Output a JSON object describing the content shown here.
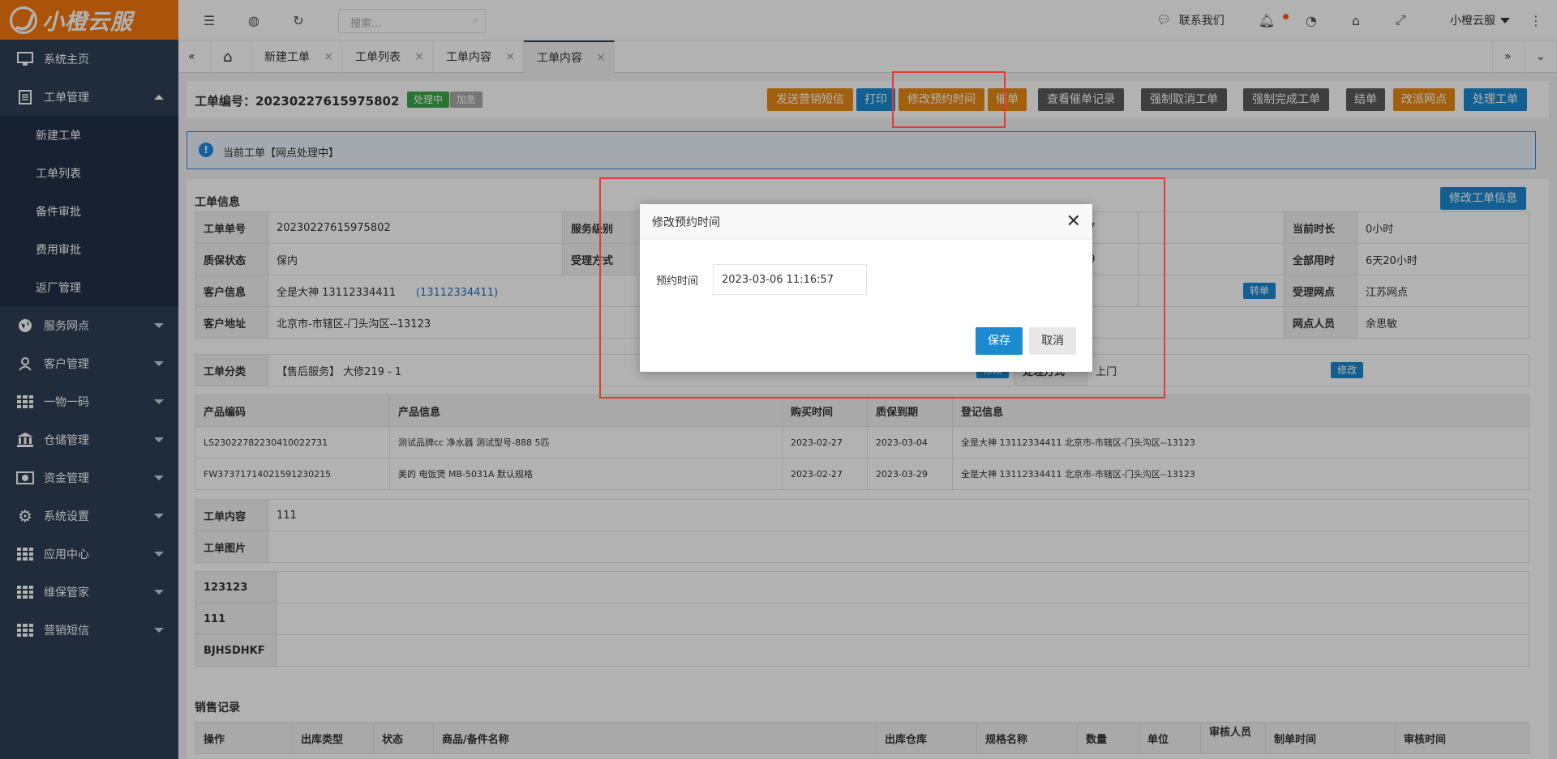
{
  "app": {
    "name": "小橙云服"
  },
  "sidebar": {
    "items": [
      {
        "label": "系统主页",
        "icon": "monitor-icon"
      },
      {
        "label": "工单管理",
        "icon": "document-icon",
        "expanded": true
      },
      {
        "label": "服务网点",
        "icon": "globe-icon"
      },
      {
        "label": "客户管理",
        "icon": "user-icon"
      },
      {
        "label": "一物一码",
        "icon": "grid-icon"
      },
      {
        "label": "仓储管理",
        "icon": "bank-icon"
      },
      {
        "label": "资金管理",
        "icon": "money-icon"
      },
      {
        "label": "系统设置",
        "icon": "gear-icon"
      },
      {
        "label": "应用中心",
        "icon": "grid-icon"
      },
      {
        "label": "维保管家",
        "icon": "grid-icon"
      },
      {
        "label": "营销短信",
        "icon": "grid-icon"
      }
    ],
    "sub_items": [
      "新建工单",
      "工单列表",
      "备件审批",
      "费用审批",
      "返厂管理"
    ]
  },
  "topbar": {
    "search_placeholder": "搜索...",
    "contact": "联系我们",
    "user": "小橙云服"
  },
  "tabs": [
    "新建工单",
    "工单列表",
    "工单内容",
    "工单内容"
  ],
  "order": {
    "number_label": "工单编号：20230227615975802",
    "status_badge": "处理中",
    "urgent_badge": "加急",
    "notice": "当前工单【网点处理中】"
  },
  "actions": [
    "发送营销短信",
    "打印",
    "修改预约时间",
    "催单",
    "查看催单记录",
    "强制取消工单",
    "强制完成工单",
    "结单",
    "改派网点",
    "处理工单"
  ],
  "info": {
    "title": "工单信息",
    "edit_button": "修改工单信息",
    "rows": [
      {
        "l1": "工单单号",
        "v1": "20230227615975802",
        "l2": "服务级别",
        "v2": "27",
        "l3": "当前时长",
        "v3": "0小时"
      },
      {
        "l1": "质保状态",
        "v1": "保内",
        "l2": "受理方式",
        "v2": "59",
        "l3": "全部用时",
        "v3": "6天20小时"
      },
      {
        "l1": "客户信息",
        "v1": "全是大神      13112334411",
        "v1b": "(13112334411)",
        "transfer": "转单",
        "l3": "受理网点",
        "v3": "江苏网点"
      },
      {
        "l1": "客户地址",
        "v1": "北京市-市辖区-门头沟区--13123",
        "l3": "网点人员",
        "v3": "余思敏"
      }
    ],
    "category_label": "工单分类",
    "category_value": "【售后服务】 大修219 - 1",
    "modify": "修改",
    "process_label": "处理方式",
    "process_value": "上门",
    "modify2": "修改"
  },
  "products": {
    "headers": [
      "产品编码",
      "产品信息",
      "购买时间",
      "质保到期",
      "登记信息"
    ],
    "rows": [
      [
        "LS23022782230410022731",
        "测试品牌cc 净水器 测试型号-888 5匹",
        "2023-02-27",
        "2023-03-04",
        "全是大神 13112334411 北京市-市辖区-门头沟区--13123"
      ],
      [
        "FW37371714021591230215",
        "美的 电饭煲 MB-5031A 默认规格",
        "2023-02-27",
        "2023-03-29",
        "全是大神 13112334411 北京市-市辖区-门头沟区--13123"
      ]
    ]
  },
  "content_rows": [
    {
      "label": "工单内容",
      "value": "111"
    },
    {
      "label": "工单图片",
      "value": ""
    }
  ],
  "custom_rows": [
    "123123",
    "111",
    "BJHSDHKF"
  ],
  "sales": {
    "title": "销售记录",
    "headers": [
      "操作",
      "出库类型",
      "状态",
      "商品/备件名称",
      "出库仓库",
      "规格名称",
      "数量",
      "单位",
      "审核人员",
      "制单时间",
      "审核时间"
    ]
  },
  "modal": {
    "title": "修改预约时间",
    "field_label": "预约时间",
    "field_value": "2023-03-06 11:16:57",
    "save": "保存",
    "cancel": "取消"
  },
  "colors": {
    "brand": "#f6780f",
    "sidebar": "#2f3e56",
    "highlight": "#e53935"
  }
}
